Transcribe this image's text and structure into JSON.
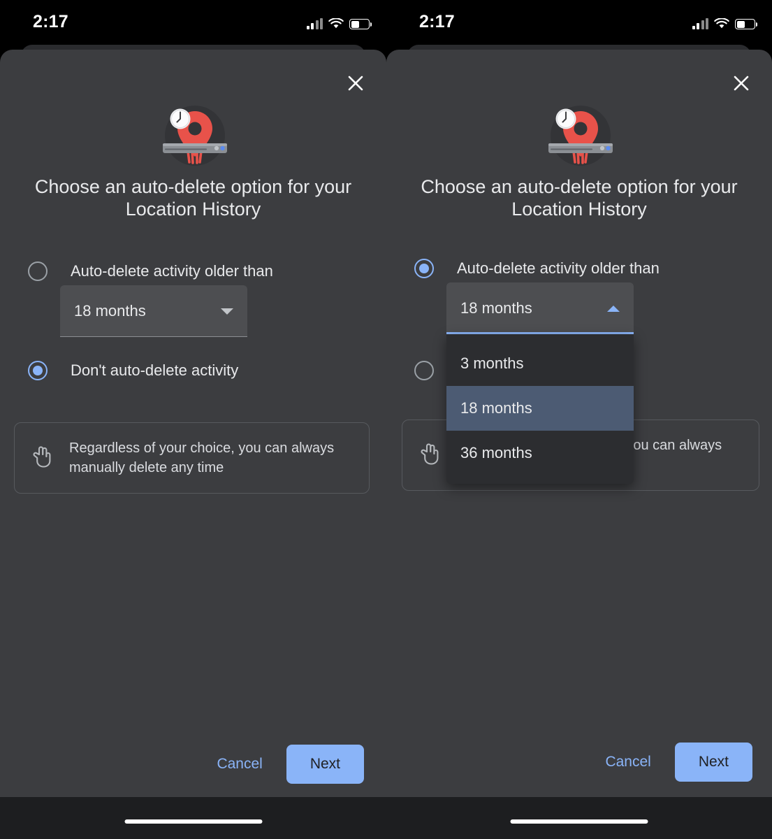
{
  "status_bar": {
    "time": "2:17",
    "signal_icon": "cellular-bars-icon",
    "wifi_icon": "wifi-icon",
    "battery_icon": "battery-icon"
  },
  "dialog": {
    "close_icon": "close-icon",
    "illustration_name": "map-pin-shredder-illustration",
    "heading": "Choose an auto-delete option for your Location History",
    "options": [
      {
        "id": "auto-delete-older-than",
        "label": "Auto-delete activity older than"
      },
      {
        "id": "dont-auto-delete",
        "label": "Don't auto-delete activity"
      }
    ],
    "select": {
      "value": "18 months",
      "caret_down_icon": "chevron-down-icon",
      "caret_up_icon": "chevron-up-icon",
      "options": [
        "3 months",
        "18 months",
        "36 months"
      ],
      "selected_option": "18 months"
    },
    "note": {
      "icon": "two-finger-tap-icon",
      "text": "Regardless of your choice, you can always manually delete any time",
      "text_line1": "Regardless of your choice, you can always",
      "text_line2": "manually delete any time",
      "visible_fragment_right": "can always"
    },
    "footer": {
      "cancel_label": "Cancel",
      "next_label": "Next"
    }
  },
  "panels": {
    "left": {
      "name": "closed-dropdown-state",
      "selected_option_id": "dont-auto-delete",
      "dropdown_open": false
    },
    "right": {
      "name": "open-dropdown-state",
      "selected_option_id": "auto-delete-older-than",
      "dropdown_open": true
    }
  },
  "colors": {
    "accent": "#8ab4f8",
    "sheet_bg": "#3c3d40",
    "menu_bg": "#2c2d30",
    "menu_selected": "#4c5b73",
    "pin_red": "#e8524a",
    "text_primary": "#e9eaec"
  }
}
